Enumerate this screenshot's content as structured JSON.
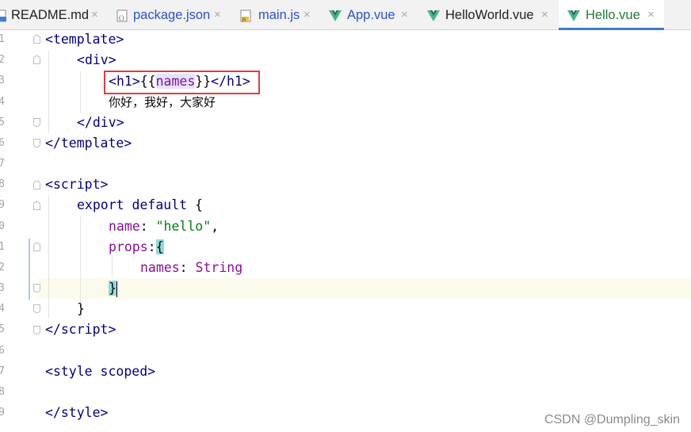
{
  "tabs": [
    {
      "label": "README.md",
      "icon": "markdown-file-icon"
    },
    {
      "label": "package.json",
      "icon": "json-file-icon"
    },
    {
      "label": "main.js",
      "icon": "js-file-icon"
    },
    {
      "label": "App.vue",
      "icon": "vue-file-icon"
    },
    {
      "label": "HelloWorld.vue",
      "icon": "vue-file-icon"
    },
    {
      "label": "Hello.vue",
      "icon": "vue-file-icon",
      "active": true
    }
  ],
  "tab_close_glyph": "×",
  "colors": {
    "vue_green": "#41b883",
    "active_tab_underline": "#3d7ec7",
    "annotation_box": "#e23c3c",
    "current_line": "#fcfaed"
  },
  "line_numbers": [
    "1",
    "2",
    "3",
    "4",
    "5",
    "6",
    "7",
    "8",
    "9",
    "0",
    "1",
    "2",
    "3",
    "4",
    "5",
    "6",
    "7",
    "8",
    "9"
  ],
  "code": {
    "l1": {
      "open": "<",
      "tag": "template",
      "close": ">"
    },
    "l2": {
      "open": "<",
      "tag": "div",
      "close": ">"
    },
    "l3": {
      "open_tag": "<",
      "tag_a": "h1",
      "gt_a": ">",
      "mustache_open": "{{",
      "var": "names",
      "mustache_close": "}}",
      "close_open": "</",
      "tag_b": "h1",
      "gt_b": ">"
    },
    "l4": {
      "text": "你好，我好，大家好"
    },
    "l5": {
      "open": "</",
      "tag": "div",
      "close": ">"
    },
    "l6": {
      "open": "</",
      "tag": "template",
      "close": ">"
    },
    "l8": {
      "open": "<",
      "tag": "script",
      "close": ">"
    },
    "l9": {
      "kw1": "export",
      "kw2": "default",
      "brace": "{"
    },
    "l10": {
      "key": "name",
      "colon": ": ",
      "value": "\"hello\"",
      "comma": ","
    },
    "l11": {
      "key": "props",
      "colon": ":",
      "brace": "{"
    },
    "l12": {
      "key": "names",
      "colon": ": ",
      "value": "String"
    },
    "l13": {
      "brace": "}"
    },
    "l14": {
      "brace": "}"
    },
    "l15": {
      "open": "</",
      "tag": "script",
      "close": ">"
    },
    "l17": {
      "open": "<",
      "tag": "style",
      "attr": "scoped",
      "close": ">"
    },
    "l19": {
      "open": "</",
      "tag": "style",
      "close": ">"
    }
  },
  "watermark": "CSDN @Dumpling_skin"
}
